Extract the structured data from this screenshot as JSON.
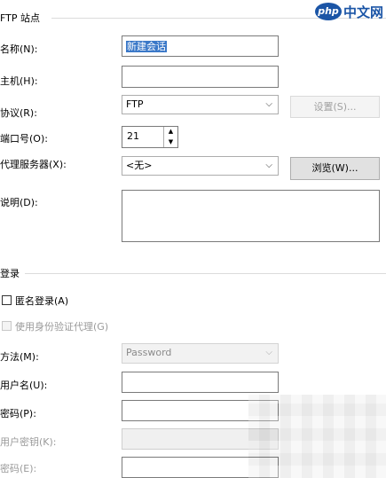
{
  "sections": {
    "ftp_site": "FTP 站点",
    "login": "登录"
  },
  "fields": {
    "name_label": "名称(N):",
    "name_value": "新建会话",
    "host_label": "主机(H):",
    "host_value": "",
    "protocol_label": "协议(R):",
    "protocol_value": "FTP",
    "settings_button": "设置(S)...",
    "port_label": "端口号(O):",
    "port_value": "21",
    "proxy_label": "代理服务器(X):",
    "proxy_value": "<无>",
    "browse_button": "浏览(W)...",
    "description_label": "说明(D):",
    "description_value": ""
  },
  "login": {
    "anonymous_label": "匿名登录(A)",
    "auth_agent_label": "使用身份验证代理(G)",
    "method_label": "方法(M):",
    "method_value": "Password",
    "username_label": "用户名(U):",
    "password_label": "密码(P):",
    "user_key_label": "用户密钥(K):",
    "passphrase_label": "密码(E):"
  },
  "logo": {
    "mark": "php",
    "text": "中文网"
  },
  "icons": {
    "dropdown": "chevron-down-icon",
    "spin_up": "triangle-up-icon",
    "spin_down": "triangle-down-icon"
  },
  "colors": {
    "selection": "#3a78c8",
    "logo": "#1b55a6"
  }
}
